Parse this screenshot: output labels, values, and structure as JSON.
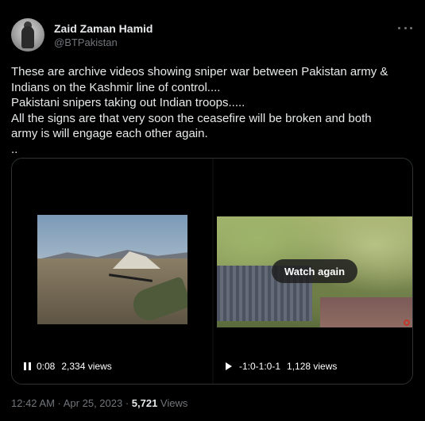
{
  "user": {
    "name": "Zaid Zaman Hamid",
    "handle": "@BTPakistan"
  },
  "tweet": {
    "lines": [
      "These are archive videos showing sniper war between Pakistan army &",
      "Indians on the Kashmir line of control....",
      "Pakistani snipers taking out Indian troops.....",
      "All the signs are that very soon the ceasefire will be broken and both",
      "army is will engage each other again.",
      ".."
    ]
  },
  "media": {
    "left": {
      "icon": "pause-icon",
      "time": "0:08",
      "views": "2,334 views"
    },
    "right": {
      "overlay": "Watch again",
      "icon": "play-icon",
      "time": "-1:0-1:0-1",
      "views": "1,128 views"
    }
  },
  "footer": {
    "timestamp": "12:42 AM · Apr 25, 2023 · ",
    "views_count": "5,721",
    "views_label": " Views"
  },
  "colors": {
    "background": "#000000",
    "text": "#e7e9ea",
    "secondary": "#71767b",
    "border": "#2f3336"
  }
}
